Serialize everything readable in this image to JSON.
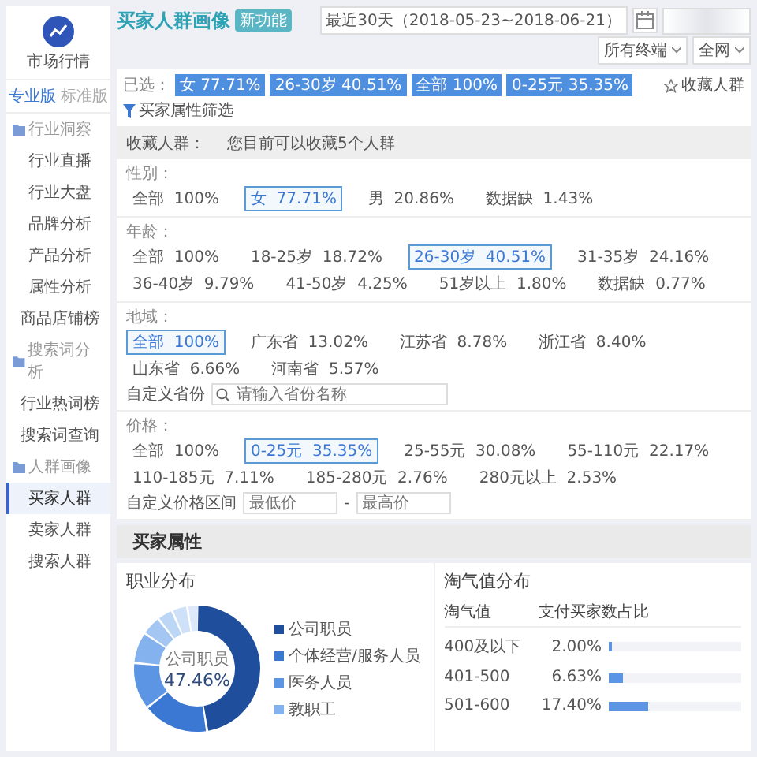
{
  "sidebar": {
    "logo_label": "市场行情",
    "tabs": [
      {
        "label": "专业版",
        "selected": true
      },
      {
        "label": "标准版",
        "selected": false
      }
    ],
    "groups": [
      {
        "title": "行业洞察",
        "items": [
          {
            "label": "行业直播",
            "selected": false
          },
          {
            "label": "行业大盘",
            "selected": false
          },
          {
            "label": "品牌分析",
            "selected": false
          },
          {
            "label": "产品分析",
            "selected": false
          },
          {
            "label": "属性分析",
            "selected": false
          },
          {
            "label": "商品店铺榜",
            "selected": false
          }
        ]
      },
      {
        "title": "搜索词分析",
        "items": [
          {
            "label": "行业热词榜",
            "selected": false
          },
          {
            "label": "搜索词查询",
            "selected": false
          }
        ]
      },
      {
        "title": "人群画像",
        "items": [
          {
            "label": "买家人群",
            "selected": true
          },
          {
            "label": "卖家人群",
            "selected": false
          },
          {
            "label": "搜索人群",
            "selected": false
          }
        ]
      }
    ]
  },
  "header": {
    "title": "买家人群画像",
    "badge": "新功能",
    "date_range": "最近30天（2018-05-23~2018-06-21）",
    "terminal": "所有终端",
    "channel": "全网"
  },
  "selected_bar": {
    "label": "已选：",
    "chips": [
      "女 77.71%",
      "26-30岁 40.51%",
      "全部 100%",
      "0-25元 35.35%"
    ],
    "collect": "收藏人群",
    "filter": "买家属性筛选"
  },
  "collect_row": {
    "label": "收藏人群：",
    "hint": "您目前可以收藏5个人群"
  },
  "filters": [
    {
      "title": "性别：",
      "options": [
        {
          "label": "全部",
          "value": "100%",
          "selected": false
        },
        {
          "label": "女",
          "value": "77.71%",
          "selected": true
        },
        {
          "label": "男",
          "value": "20.86%",
          "selected": false
        },
        {
          "label": "数据缺",
          "value": "1.43%",
          "selected": false
        }
      ]
    },
    {
      "title": "年龄：",
      "options": [
        {
          "label": "全部",
          "value": "100%",
          "selected": false
        },
        {
          "label": "18-25岁",
          "value": "18.72%",
          "selected": false
        },
        {
          "label": "26-30岁",
          "value": "40.51%",
          "selected": true
        },
        {
          "label": "31-35岁",
          "value": "24.16%",
          "selected": false
        },
        {
          "label": "36-40岁",
          "value": "9.79%",
          "selected": false
        },
        {
          "label": "41-50岁",
          "value": "4.25%",
          "selected": false
        },
        {
          "label": "51岁以上",
          "value": "1.80%",
          "selected": false
        },
        {
          "label": "数据缺",
          "value": "0.77%",
          "selected": false
        }
      ]
    },
    {
      "title": "地域：",
      "options": [
        {
          "label": "全部",
          "value": "100%",
          "selected": true
        },
        {
          "label": "广东省",
          "value": "13.02%",
          "selected": false
        },
        {
          "label": "江苏省",
          "value": "8.78%",
          "selected": false
        },
        {
          "label": "浙江省",
          "value": "8.40%",
          "selected": false
        },
        {
          "label": "山东省",
          "value": "6.66%",
          "selected": false
        },
        {
          "label": "河南省",
          "value": "5.57%",
          "selected": false
        }
      ],
      "custom": {
        "kind": "search",
        "label": "自定义省份",
        "placeholder": "请输入省份名称"
      }
    },
    {
      "title": "价格：",
      "options": [
        {
          "label": "全部",
          "value": "100%",
          "selected": false
        },
        {
          "label": "0-25元",
          "value": "35.35%",
          "selected": true
        },
        {
          "label": "25-55元",
          "value": "30.08%",
          "selected": false
        },
        {
          "label": "55-110元",
          "value": "22.17%",
          "selected": false
        },
        {
          "label": "110-185元",
          "value": "7.11%",
          "selected": false
        },
        {
          "label": "185-280元",
          "value": "2.76%",
          "selected": false
        },
        {
          "label": "280元以上",
          "value": "2.53%",
          "selected": false
        }
      ],
      "custom": {
        "kind": "range",
        "label": "自定义价格区间",
        "min_placeholder": "最低价",
        "separator": "-",
        "max_placeholder": "最高价"
      }
    }
  ],
  "attributes": {
    "title": "买家属性",
    "occupation": {
      "title": "职业分布",
      "center_label": "公司职员",
      "center_value": "47.46%",
      "legend": [
        {
          "label": "公司职员",
          "color": "#1f4e9c"
        },
        {
          "label": "个体经营/服务人员",
          "color": "#3a78d4"
        },
        {
          "label": "医务人员",
          "color": "#5b95e4"
        },
        {
          "label": "教职工",
          "color": "#84b2ee"
        }
      ]
    },
    "naughty": {
      "title": "淘气值分布",
      "columns": [
        "淘气值",
        "支付买家数占比"
      ],
      "rows": [
        {
          "range": "400及以下",
          "share": "2.00%",
          "level": 0.03
        },
        {
          "range": "401-500",
          "share": "6.63%",
          "level": 0.11
        },
        {
          "range": "501-600",
          "share": "17.40%",
          "level": 0.3
        }
      ]
    }
  }
}
